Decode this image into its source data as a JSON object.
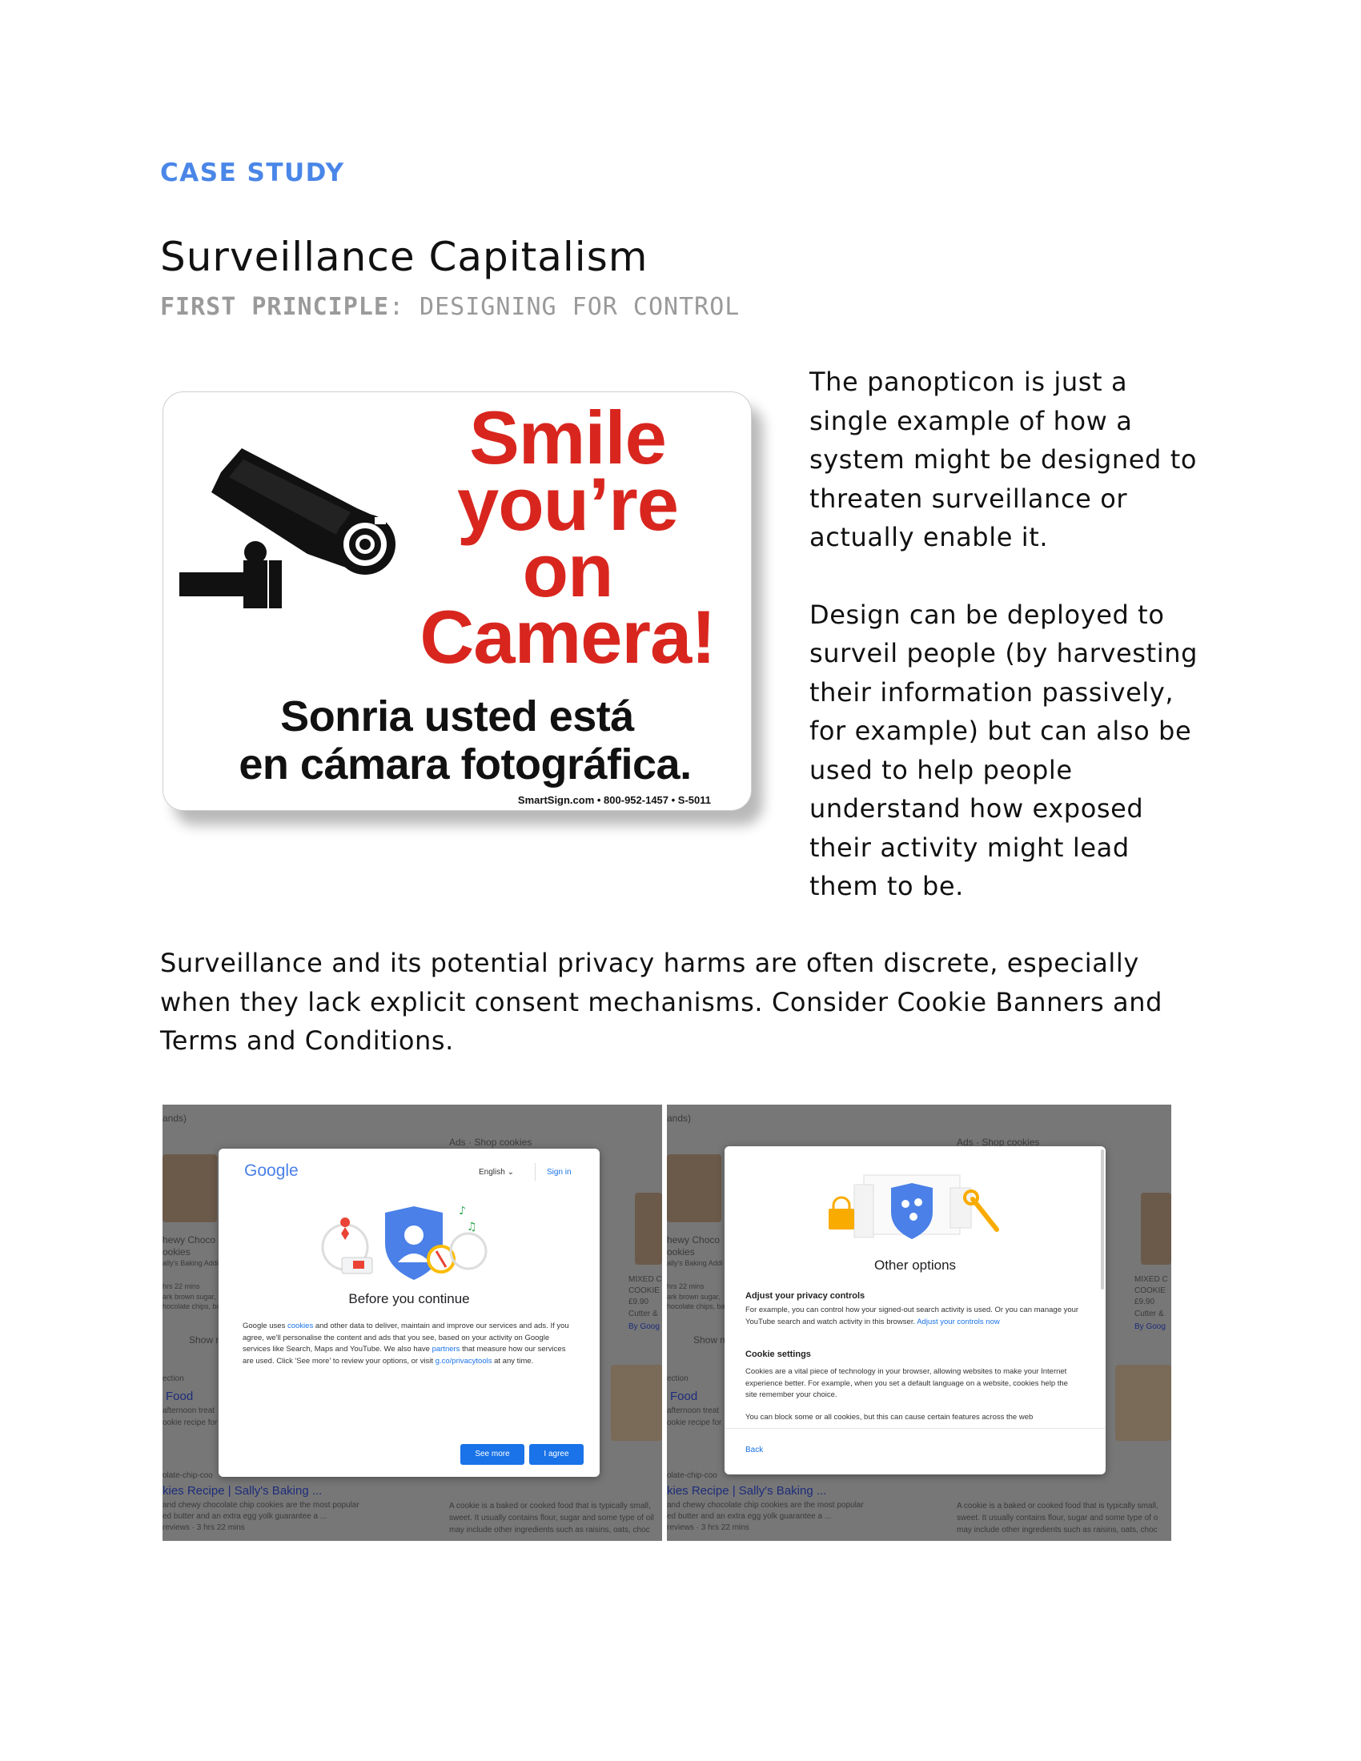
{
  "header": {
    "eyebrow": "CASE STUDY",
    "title": "Surveillance Capitalism",
    "subtitle_bold": "FIRST PRINCIPLE",
    "subtitle_rest": ": DESIGNING FOR CONTROL"
  },
  "sign": {
    "line1": "Smile",
    "line2": "you’re",
    "line3": "on",
    "line4": "Camera!",
    "spanish_line1": "Sonria usted está",
    "spanish_line2": "en cámara fotográfica.",
    "credit": "SmartSign.com • 800-952-1457 • S-5011",
    "colors": {
      "red": "#d8261f",
      "black": "#111111"
    }
  },
  "side_text": {
    "p1": "The panopticon is just a single example of how a system might be designed to threaten surveillance or actually enable it.",
    "p2": "Design can be deployed to surveil people (by harvesting their information passively, for example) but can also be used to help people understand how exposed their activity might lead them to be."
  },
  "wide_paragraph": "Surveillance and its potential privacy harms are often discrete, especially when they lack explicit consent mechanisms. Consider Cookie Banners and Terms and Conditions.",
  "screenshot_left": {
    "bg": {
      "t1": "ands)",
      "t2": "Ads · Shop cookies",
      "t3": "hewy Choco",
      "t4": "ookies",
      "t5": "ally's Baking Addi",
      "t6": "hrs 22 mins",
      "t7": "ark brown sugar,",
      "t8": "hocolate chips, ba",
      "t9": "Show m",
      "t10": "ection",
      "t11": "Food",
      "t12": "afternoon treat",
      "t13": "ookie recipe for",
      "t14": "MIXED C",
      "t15": "COOKIE",
      "t16": "£9.90",
      "t17": "Cutter &",
      "t18": "By Goog",
      "t19": "olate-chip-coo",
      "t20": "kies Recipe | Sally's Baking ...",
      "t21": "and chewy chocolate chip cookies are the most popular",
      "t22": "ed butter and an extra egg yolk guarantee a ...",
      "t23": "reviews · 3 hrs 22 mins",
      "t24": "A cookie is a baked or cooked food that is typically small,",
      "t25": "sweet. It usually contains flour, sugar and some type of oil",
      "t26": "may include other ingredients such as raisins, oats, choc"
    },
    "dialog": {
      "logo": "Google",
      "language": "English",
      "signin": "Sign in",
      "title": "Before you continue",
      "body_a": "Google uses ",
      "body_link1": "cookies",
      "body_b": " and other data to deliver, maintain and improve our services and ads. If you agree, we'll personalise the content and ads that you see, based on your activity on Google services like Search, Maps and YouTube. We also have ",
      "body_link2": "partners",
      "body_c": " that measure how our services are used. Click 'See more' to review your options, or visit ",
      "body_link3": "g.co/privacytools",
      "body_d": " at any time.",
      "see_more": "See more",
      "agree": "I agree"
    }
  },
  "screenshot_right": {
    "bg": {
      "t1": "ands)",
      "t2": "Ads · Shop cookies",
      "t3": "hewy Choco",
      "t4": "ookies",
      "t5": "ally's Baking Addi",
      "t6": "hrs 22 mins",
      "t7": "ark brown sugar,",
      "t8": "hocolate chips, ba",
      "t9": "Show m",
      "t10": "ection",
      "t11": "Food",
      "t12": "afternoon treat",
      "t13": "ookie recipe for",
      "t14": "MIXED C",
      "t15": "COOKIE",
      "t16": "£9.90",
      "t17": "Cutter &",
      "t18": "By Goog",
      "t19": "olate-chip-coo",
      "t20": "kies Recipe | Sally's Baking ...",
      "t21": "and chewy chocolate chip cookies are the most popular",
      "t22": "ed butter and an extra egg yolk guarantee a ...",
      "t23": "reviews · 3 hrs 22 mins",
      "t24": "A cookie is a baked or cooked food that is typically small,",
      "t25": "sweet. It usually contains flour, sugar and some type of o",
      "t26": "may include other ingredients such as raisins, oats, choc"
    },
    "dialog": {
      "title": "Other options",
      "h1": "Adjust your privacy controls",
      "p1": "For example, you can control how your signed-out search activity is used. Or you can manage your YouTube search and watch activity in this browser. ",
      "p1_link": "Adjust your controls now",
      "h2": "Cookie settings",
      "p2": "Cookies are a vital piece of technology in your browser, allowing websites to make your Internet experience better. For example, when you set a default language on a website, cookies help the site remember your choice.",
      "p3": "You can block some or all cookies, but this can cause certain features across the web",
      "back": "Back"
    }
  }
}
